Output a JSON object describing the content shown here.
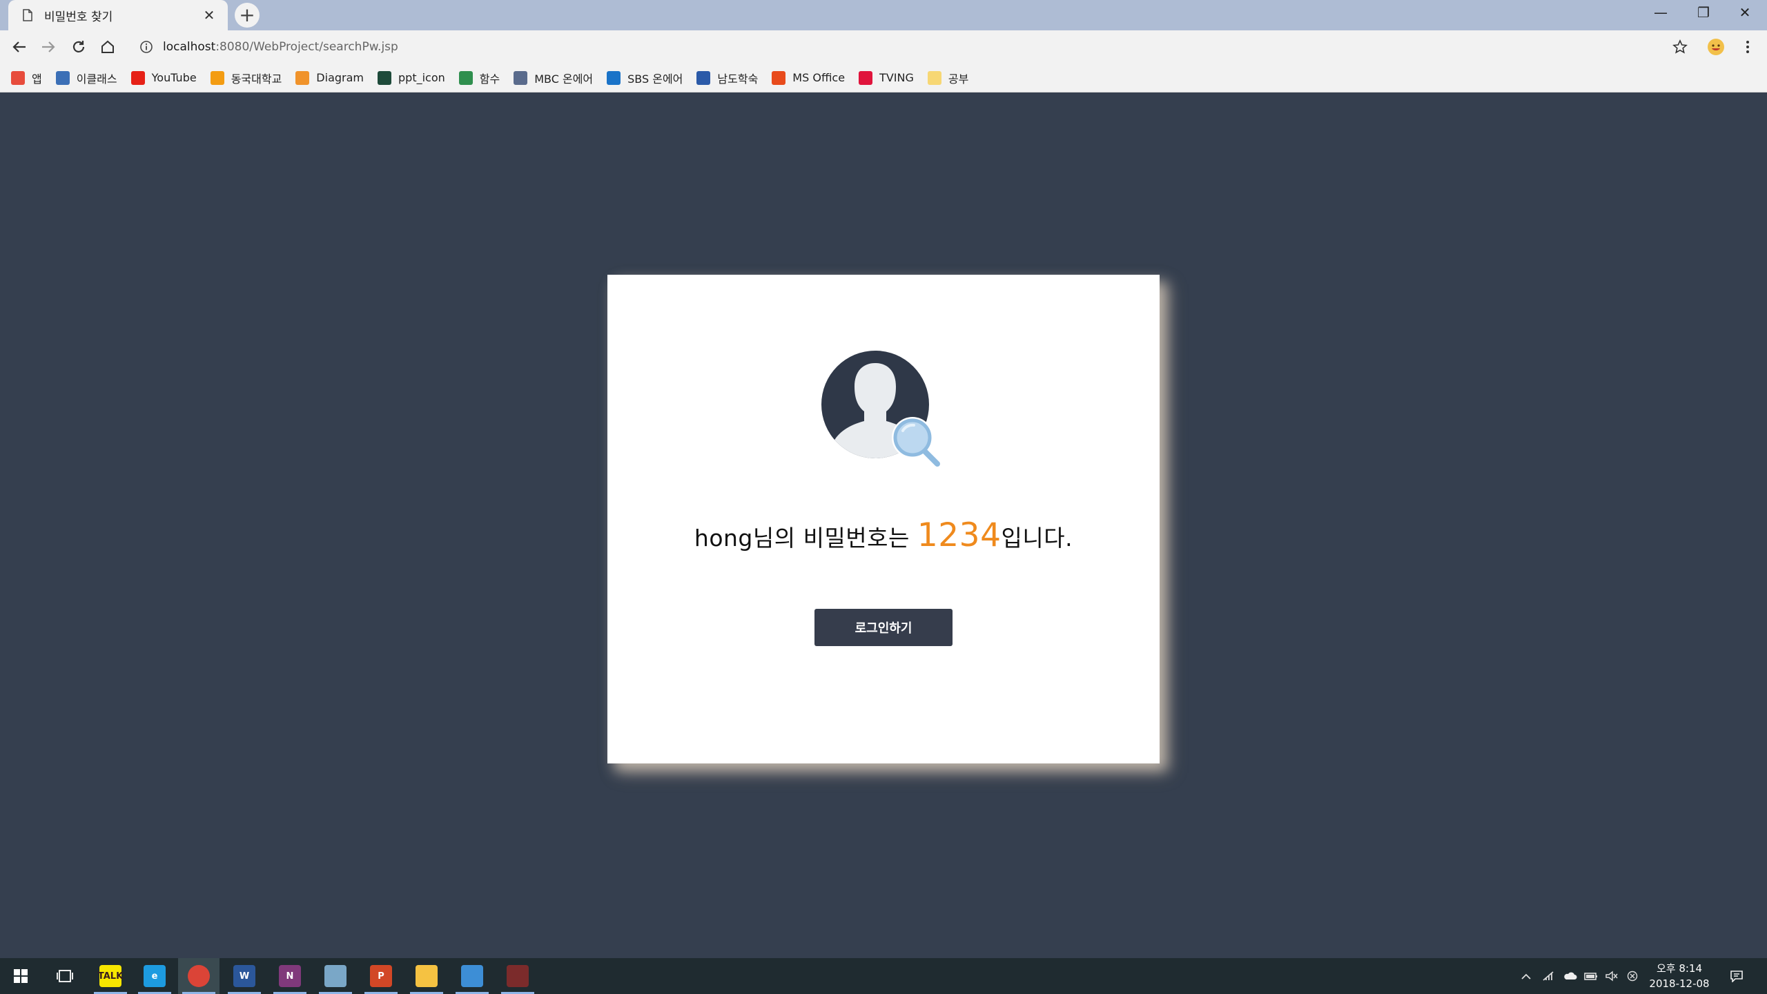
{
  "browser": {
    "tab": {
      "title": "비밀번호 찾기",
      "close": "✕"
    },
    "new_tab": "+",
    "window_controls": {
      "minimize": "—",
      "restore": "❐",
      "close": "✕"
    },
    "address": {
      "host": "localhost",
      "rest": ":8080/WebProject/searchPw.jsp"
    }
  },
  "bookmarks": [
    {
      "label": "앱",
      "icon": "apps-grid-icon",
      "color": "#e74c3c"
    },
    {
      "label": "이클래스",
      "icon": "eclass-icon",
      "color": "#3b6fb6"
    },
    {
      "label": "YouTube",
      "icon": "youtube-icon",
      "color": "#e62117"
    },
    {
      "label": "동국대학교",
      "icon": "dongguk-icon",
      "color": "#f39c12"
    },
    {
      "label": "Diagram",
      "icon": "diagram-icon",
      "color": "#f0932b"
    },
    {
      "label": "ppt_icon",
      "icon": "ppt-icon-bookmark",
      "color": "#1e4a3a"
    },
    {
      "label": "함수",
      "icon": "function-icon",
      "color": "#2f8f4e"
    },
    {
      "label": "MBC 온에어",
      "icon": "mbc-icon",
      "color": "#5a6b8c"
    },
    {
      "label": "SBS 온에어",
      "icon": "sbs-icon",
      "color": "#1a73c8"
    },
    {
      "label": "남도학숙",
      "icon": "namdo-icon",
      "color": "#2b5aa8"
    },
    {
      "label": "MS Office",
      "icon": "office-icon",
      "color": "#e84b1c"
    },
    {
      "label": "TVING",
      "icon": "tving-icon",
      "color": "#e0143c"
    },
    {
      "label": "공부",
      "icon": "folder-icon",
      "color": "#f7d774"
    }
  ],
  "result": {
    "username": "hong",
    "prefix": "님의 비밀번호는 ",
    "password": "1234",
    "suffix": "입니다."
  },
  "login_button": "로그인하기",
  "colors": {
    "background": "#353f4f",
    "accent": "#ef8a1d",
    "button": "#363d4c"
  },
  "taskbar": {
    "apps": [
      {
        "name": "kakaotalk",
        "label": "TALK",
        "color": "#f7e600"
      },
      {
        "name": "internet-explorer",
        "label": "e",
        "color": "#1d9be0"
      },
      {
        "name": "chrome",
        "label": "",
        "color": "#db4437"
      },
      {
        "name": "word",
        "label": "W",
        "color": "#2b579a"
      },
      {
        "name": "onenote",
        "label": "N",
        "color": "#80397b"
      },
      {
        "name": "notes",
        "label": "",
        "color": "#7aa7c7"
      },
      {
        "name": "powerpoint",
        "label": "P",
        "color": "#d24726"
      },
      {
        "name": "file-explorer",
        "label": "",
        "color": "#f5c242"
      },
      {
        "name": "editor",
        "label": "",
        "color": "#3d8ed6"
      },
      {
        "name": "game",
        "label": "",
        "color": "#7b2b2b"
      }
    ],
    "clock": {
      "time": "오후 8:14",
      "date": "2018-12-08"
    }
  }
}
